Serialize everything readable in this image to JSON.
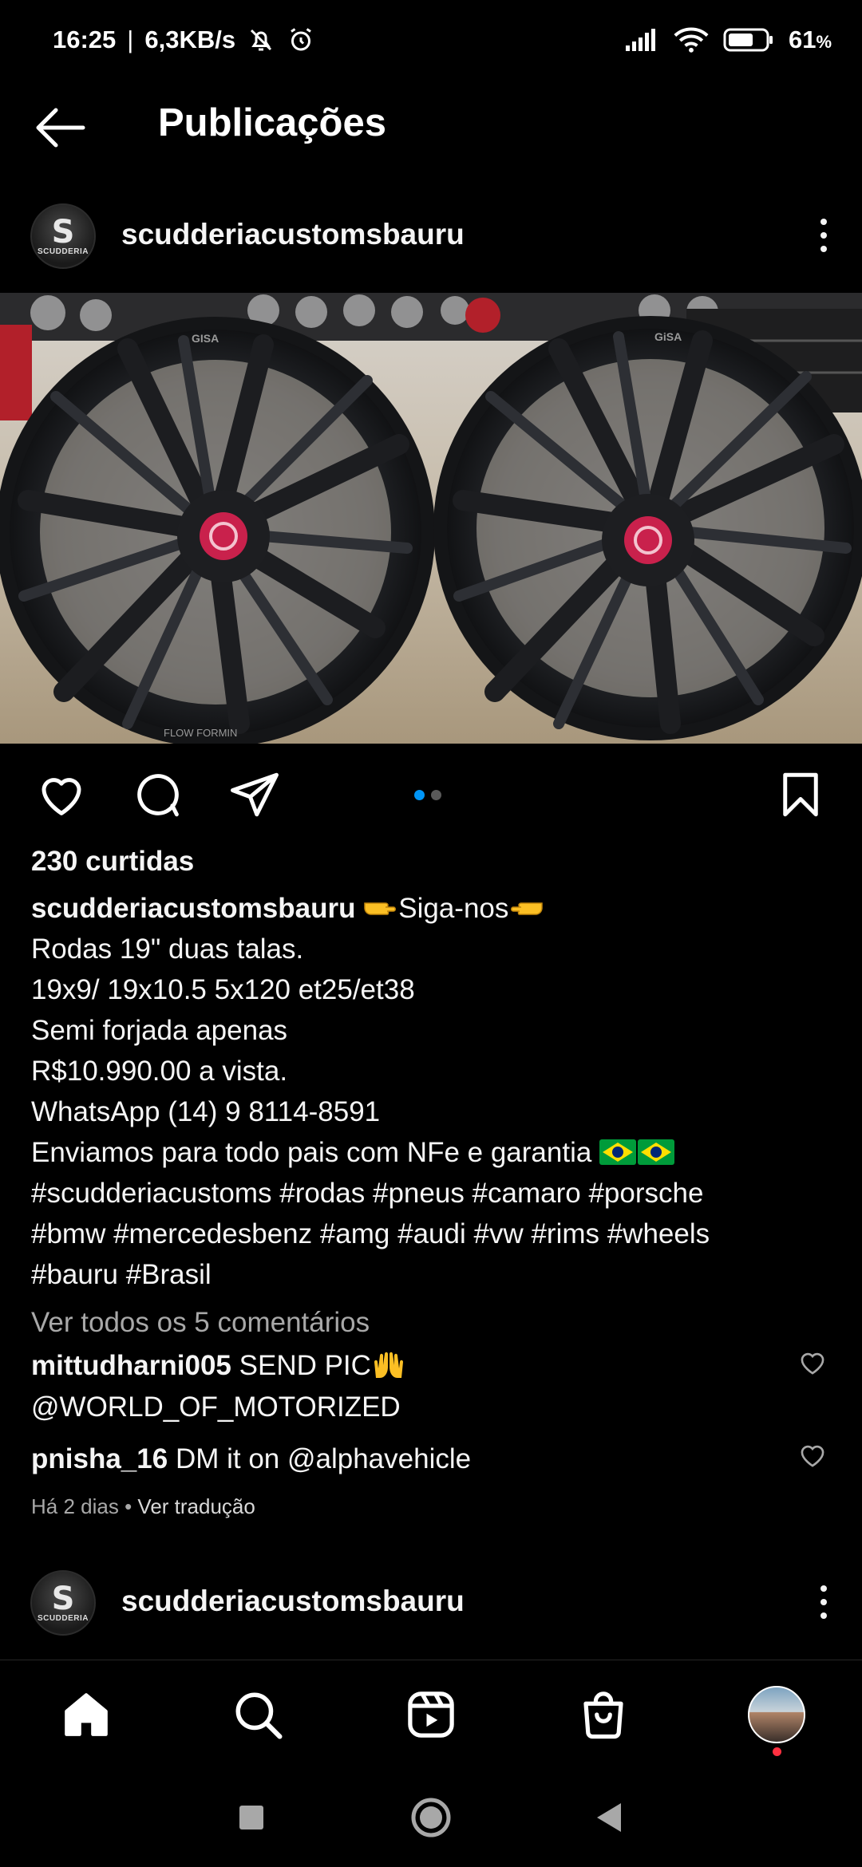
{
  "status_bar": {
    "time": "16:25",
    "network_speed": "6,3KB/s",
    "battery": "61",
    "battery_unit": "%"
  },
  "header": {
    "title": "Publicações"
  },
  "post": {
    "username": "scudderiacustomsbauru",
    "avatar_text_main": "S",
    "avatar_text_sub": "SCUDDERIA",
    "image_text_left": "GISA",
    "image_text_right": "GiSA",
    "image_text_rim": "FLOW FORMIN",
    "carousel_index": 1,
    "carousel_count": 2,
    "likes": "230 curtidas",
    "caption": {
      "user": "scudderiacustomsbauru",
      "first_text": "Siga-nos",
      "lines": [
        "Rodas 19\" duas talas.",
        "19x9/ 19x10.5 5x120 et25/et38",
        "Semi forjada apenas",
        "R$10.990.00 a vista.",
        "WhatsApp (14) 9 8114-8591",
        "Enviamos para todo pais com NFe e garantia",
        "#scudderiacustoms #rodas #pneus #camaro #porsche",
        "#bmw #mercedesbenz #amg #audi #vw #rims #wheels",
        "#bauru #Brasil"
      ]
    },
    "view_comments": "Ver todos os 5 comentários",
    "comments": [
      {
        "user": "mittudharni005",
        "text": "SEND PIC",
        "text2": "@WORLD_OF_MOTORIZED"
      },
      {
        "user": "pnisha_16",
        "text": "DM it on @alphavehicle"
      }
    ],
    "time_ago": "Há 2 dias",
    "separator": "•",
    "translate": "Ver tradução"
  },
  "next_post": {
    "username": "scudderiacustomsbauru"
  },
  "colors": {
    "background": "#000000",
    "text": "#f5f5f5",
    "muted": "#a8a8a8",
    "carousel_active": "#0095f6",
    "notification": "#ff3040"
  },
  "icons": [
    "back-arrow-icon",
    "heart-icon",
    "comment-icon",
    "share-icon",
    "bookmark-icon",
    "home-icon",
    "search-icon",
    "reels-icon",
    "shop-icon",
    "more-icon"
  ]
}
